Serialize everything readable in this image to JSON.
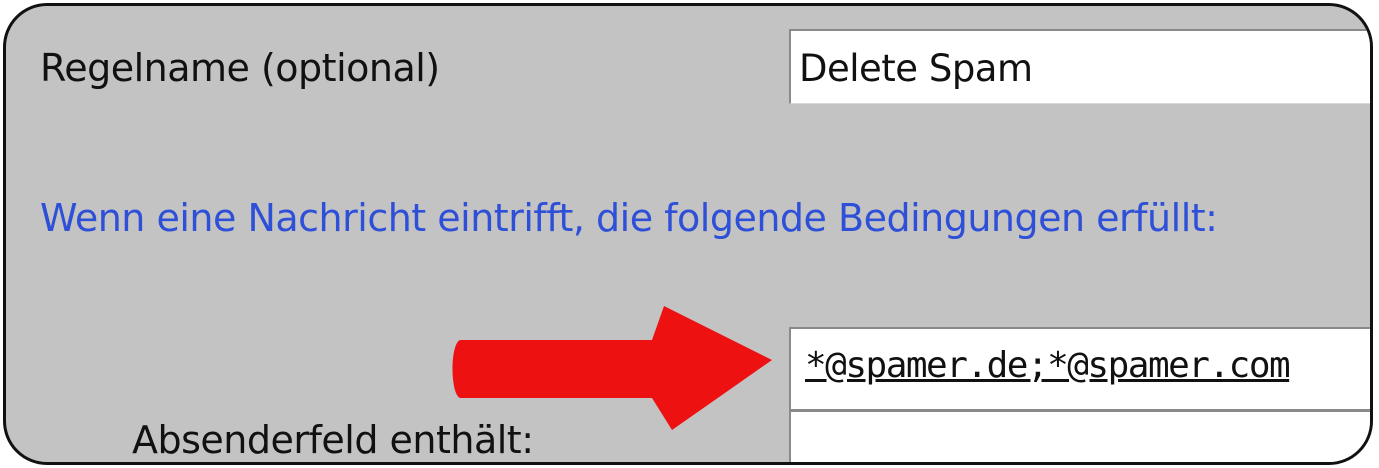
{
  "rule_form": {
    "rule_name_label": "Regelname  (optional)",
    "rule_name_value": "Delete Spam",
    "condition_heading": "Wenn eine Nachricht eintrifft, die folgende Bedingungen erfüllt:",
    "sender_label": "Absenderfeld enthält:",
    "sender_value": "*@spamer.de;*@spamer.com"
  },
  "colors": {
    "panel_background": "#c3c3c3",
    "heading_text": "#2e4fd8",
    "annotation_arrow": "#ee1111"
  },
  "icons": {
    "annotation": "arrow-right-icon"
  }
}
